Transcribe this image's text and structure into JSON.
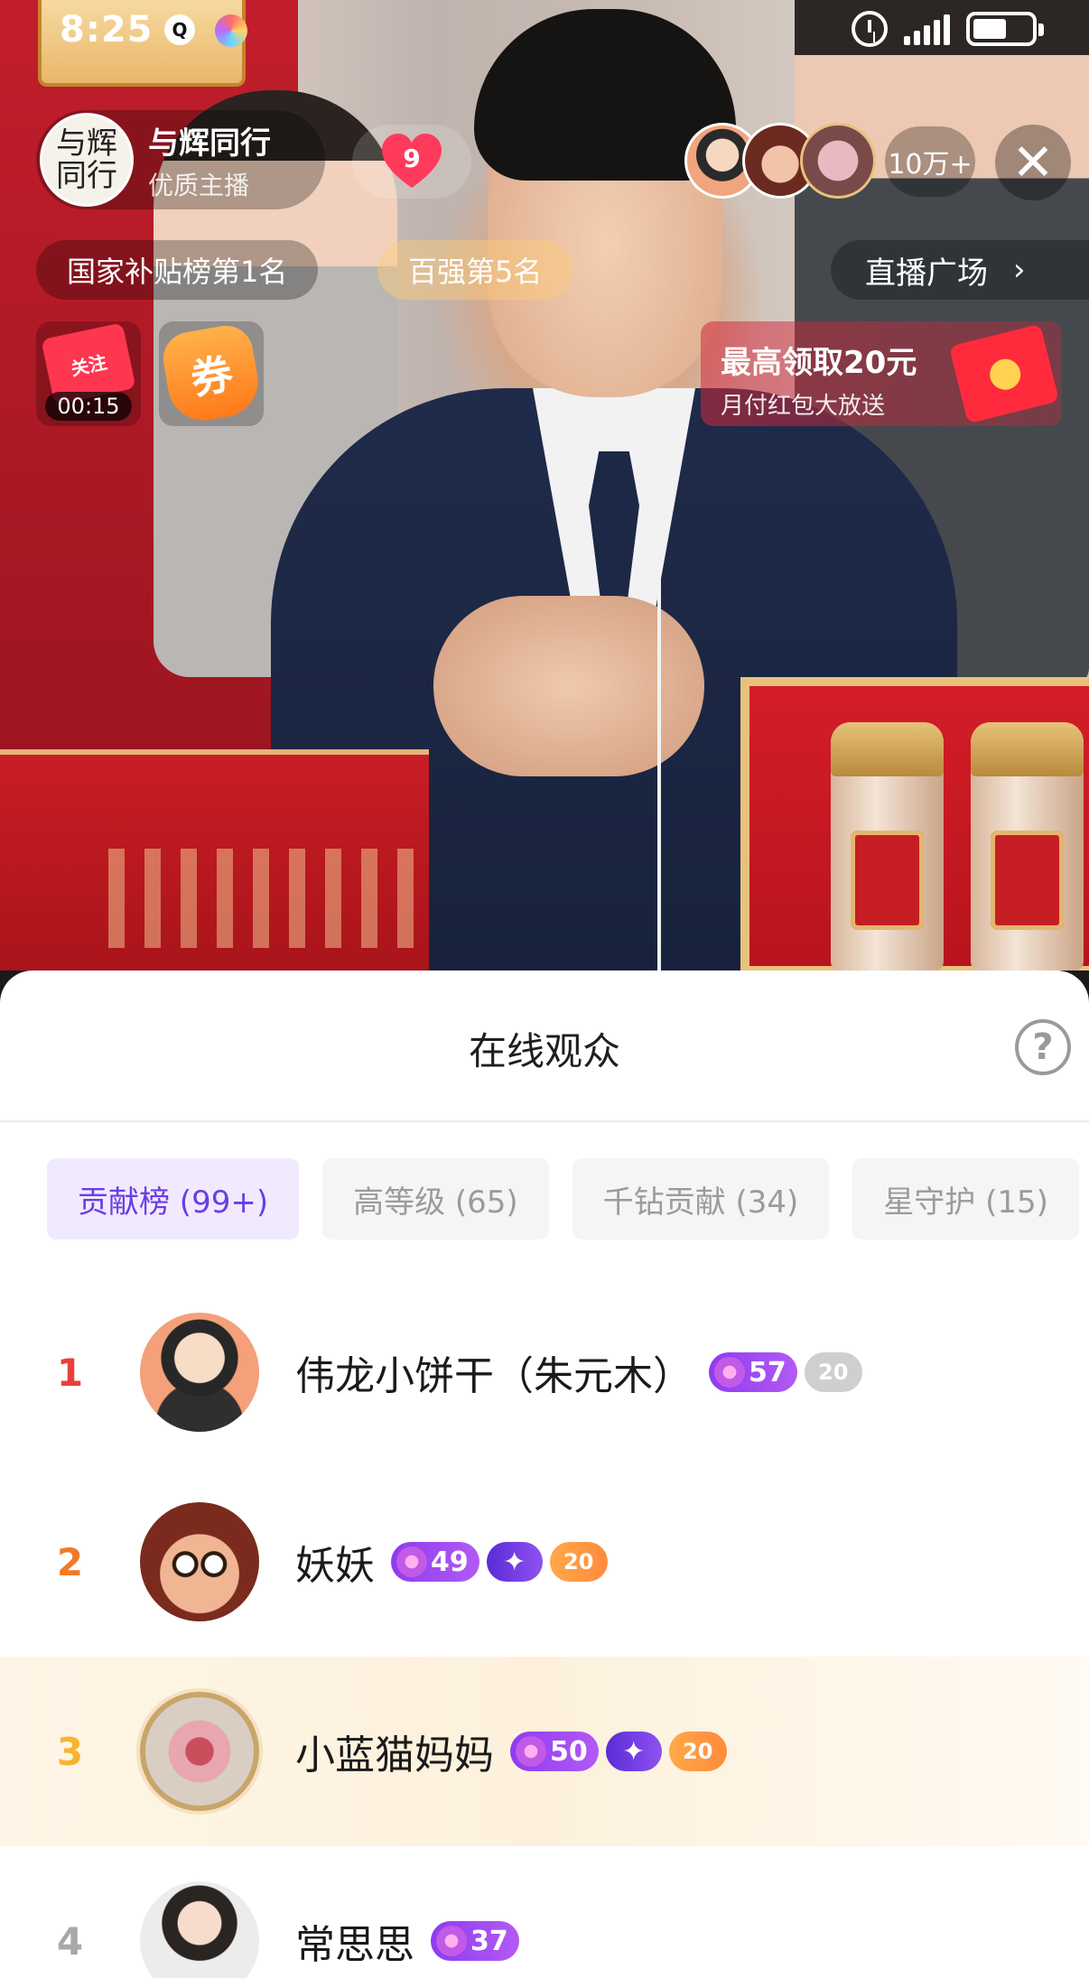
{
  "status_bar": {
    "time": "8:25",
    "qq_icon": "qq-icon",
    "alarm_icon": "alarm-icon",
    "signal_icon": "signal-icon",
    "battery_icon": "battery-icon"
  },
  "host": {
    "avatar_text": "与辉\n同行",
    "name": "与辉同行",
    "subtitle": "优质主播",
    "heart_count": "9"
  },
  "viewers": {
    "count": "10万+"
  },
  "rank_tags": {
    "subsidy_rank": "国家补贴榜第1名",
    "top100_rank": "百强第5名",
    "plaza": "直播广场"
  },
  "widgets": {
    "follow_label": "关注",
    "timer": "00:15",
    "coupon_label": "券",
    "redpack_title": "最高领取20元",
    "redpack_subtitle": "月付红包大放送"
  },
  "sheet": {
    "title": "在线观众",
    "help": "?",
    "tabs": [
      {
        "label": "贡献榜 (99+)",
        "active": true
      },
      {
        "label": "高等级 (65)",
        "active": false
      },
      {
        "label": "千钻贡献 (34)",
        "active": false
      },
      {
        "label": "星守护 (15)",
        "active": false
      }
    ],
    "rows": [
      {
        "rank": "1",
        "name": "伟龙小饼干（朱元木）",
        "level": "57",
        "fan_level": "20"
      },
      {
        "rank": "2",
        "name": "妖妖",
        "level": "49",
        "fan_level": "20"
      },
      {
        "rank": "3",
        "name": "小蓝猫妈妈",
        "level": "50",
        "fan_level": "20"
      },
      {
        "rank": "4",
        "name": "常思思",
        "level": "37"
      }
    ]
  },
  "colors": {
    "accent_purple": "#6b3ee6",
    "rank1": "#e8403c",
    "rank2": "#f07a2a",
    "rank3": "#f6b52e",
    "rank4": "#a8a8a8"
  }
}
